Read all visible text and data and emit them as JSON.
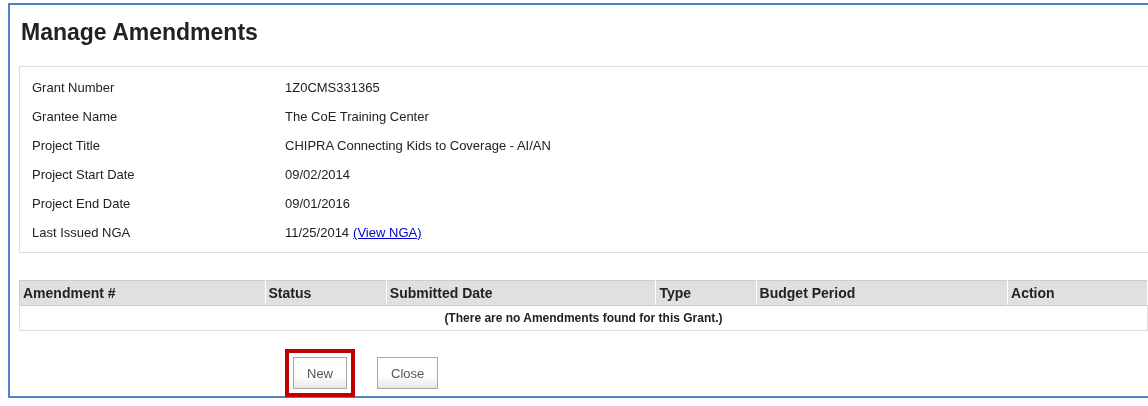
{
  "title": "Manage Amendments",
  "details": [
    {
      "label": "Grant Number",
      "value": "1Z0CMS331365"
    },
    {
      "label": "Grantee Name",
      "value": "The CoE Training Center"
    },
    {
      "label": "Project Title",
      "value": "CHIPRA Connecting Kids to Coverage - AI/AN"
    },
    {
      "label": "Project Start Date",
      "value": "09/02/2014"
    },
    {
      "label": "Project End Date",
      "value": "09/01/2016"
    },
    {
      "label": "Last Issued NGA",
      "value": "11/25/2014",
      "link": "(View NGA)"
    }
  ],
  "table": {
    "columns": [
      "Amendment #",
      "Status",
      "Submitted Date",
      "Type",
      "Budget Period",
      "Action"
    ],
    "empty_message": "(There are no Amendments found for this Grant.)"
  },
  "buttons": [
    {
      "label": "New",
      "highlighted": true
    },
    {
      "label": "Close",
      "highlighted": false
    }
  ]
}
